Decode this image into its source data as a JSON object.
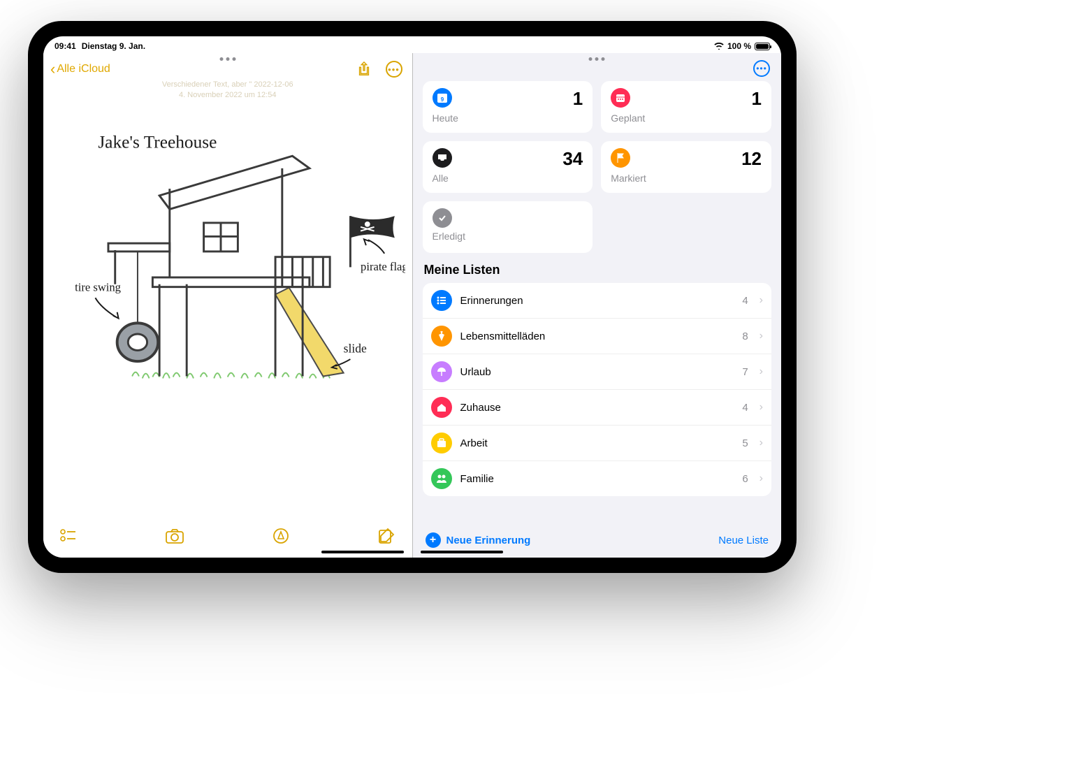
{
  "status": {
    "time": "09:41",
    "date": "Dienstag 9. Jan.",
    "battery_pct": "100 %"
  },
  "notes": {
    "back_label": "Alle iCloud",
    "meta_line1": "Verschiedener Text, aber \" 2022-12-06",
    "meta_line2": "4. November 2022 um 12:54",
    "sketch": {
      "title": "Jake's Treehouse",
      "label_tire": "tire swing",
      "label_flag": "pirate flag",
      "label_slide": "slide"
    }
  },
  "reminders": {
    "cards": {
      "today": {
        "label": "Heute",
        "count": "1",
        "color": "#007aff"
      },
      "scheduled": {
        "label": "Geplant",
        "count": "1",
        "color": "#ff2d55"
      },
      "all": {
        "label": "Alle",
        "count": "34",
        "color": "#1c1c1e"
      },
      "flagged": {
        "label": "Markiert",
        "count": "12",
        "color": "#ff9500"
      },
      "completed": {
        "label": "Erledigt",
        "count": "",
        "color": "#8e8e93"
      }
    },
    "section_title": "Meine Listen",
    "lists": [
      {
        "name": "Erinnerungen",
        "count": "4",
        "color": "#007aff",
        "icon": "list"
      },
      {
        "name": "Lebensmittelläden",
        "count": "8",
        "color": "#ff9500",
        "icon": "carrot"
      },
      {
        "name": "Urlaub",
        "count": "7",
        "color": "#c77dff",
        "icon": "umbrella"
      },
      {
        "name": "Zuhause",
        "count": "4",
        "color": "#ff2d55",
        "icon": "house"
      },
      {
        "name": "Arbeit",
        "count": "5",
        "color": "#ffcc00",
        "icon": "briefcase"
      },
      {
        "name": "Familie",
        "count": "6",
        "color": "#34c759",
        "icon": "people"
      }
    ],
    "new_reminder_label": "Neue Erinnerung",
    "new_list_label": "Neue Liste"
  }
}
